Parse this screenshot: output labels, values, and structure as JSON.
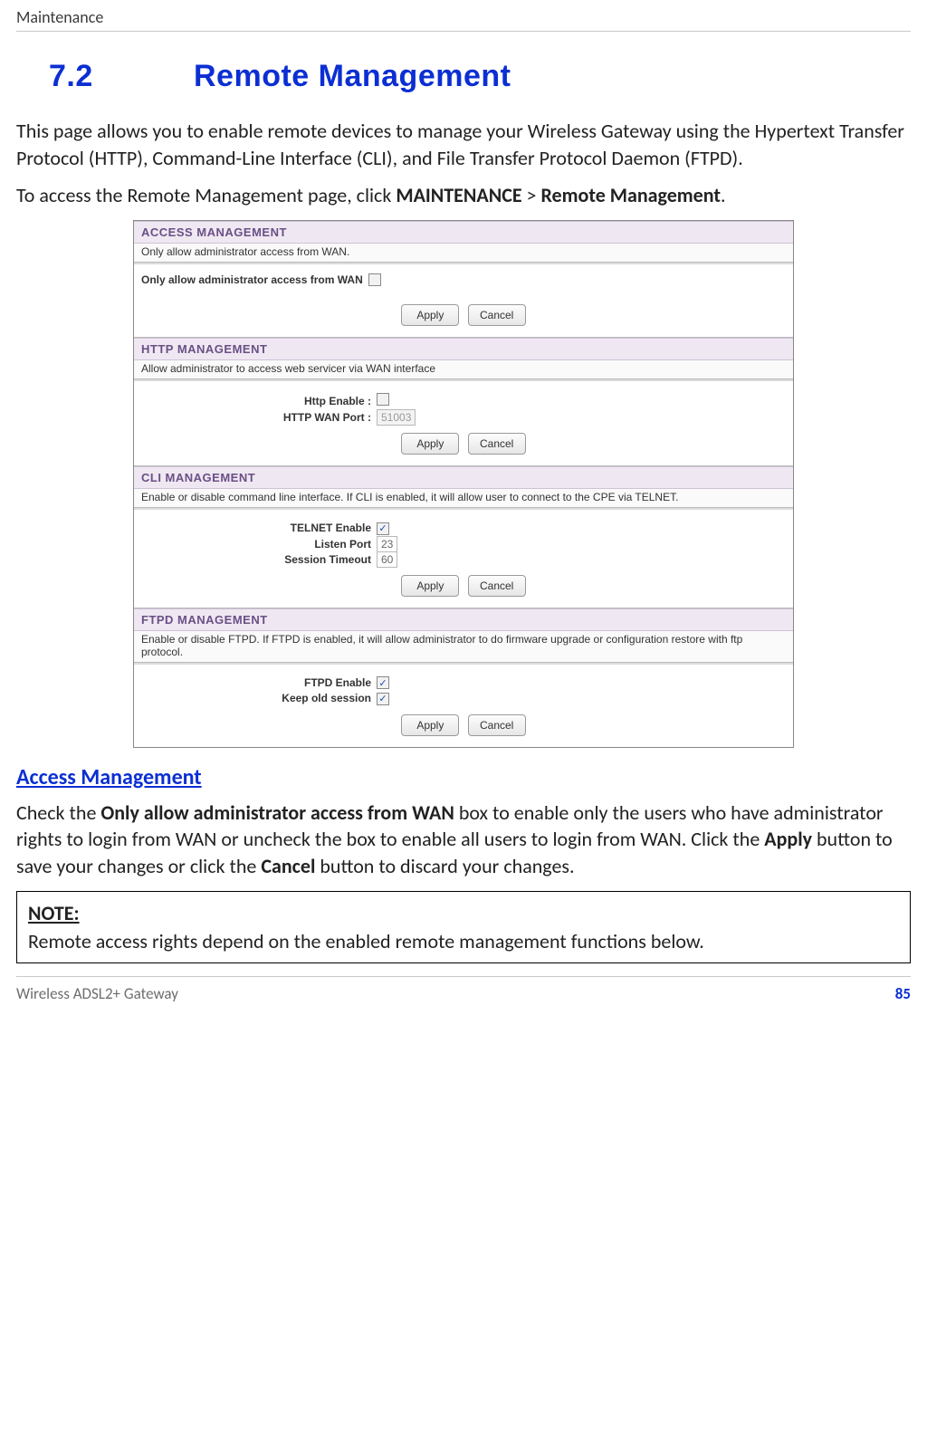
{
  "header": {
    "chapter": "Maintenance"
  },
  "section": {
    "number": "7.2",
    "title": "Remote Management"
  },
  "intro": {
    "p1": "This page allows you to enable remote devices to manage your Wireless Gateway using the Hypertext Transfer Protocol (HTTP), Command-Line Interface (CLI), and File Transfer Protocol Daemon (FTPD).",
    "p2a": "To access the Remote Management page, click ",
    "p2b": "MAINTENANCE",
    "p2c": " > ",
    "p2d": "Remote Management",
    "p2e": "."
  },
  "buttons": {
    "apply": "Apply",
    "cancel": "Cancel"
  },
  "shot": {
    "access": {
      "title": "ACCESS MANAGEMENT",
      "desc": "Only allow administrator access from WAN.",
      "checkbox_label": "Only allow administrator access from WAN",
      "checked": ""
    },
    "http": {
      "title": "HTTP MANAGEMENT",
      "desc": "Allow administrator to access web servicer via WAN interface",
      "enable_label": "Http Enable  :",
      "port_label": "HTTP WAN Port  :",
      "port_value": "51003",
      "enable_checked": ""
    },
    "cli": {
      "title": "CLI MANAGEMENT",
      "desc": "Enable or disable command line interface. If CLI is enabled, it will allow user to connect to the CPE via TELNET.",
      "telnet_label": "TELNET Enable",
      "telnet_checked": "✓",
      "listen_label": "Listen Port",
      "listen_value": "23",
      "timeout_label": "Session Timeout",
      "timeout_value": "60"
    },
    "ftpd": {
      "title": "FTPD MANAGEMENT",
      "desc": "Enable or disable FTPD. If FTPD is enabled, it will allow administrator to do firmware upgrade or configuration restore with ftp protocol.",
      "enable_label": "FTPD Enable",
      "enable_checked": "✓",
      "keep_label": "Keep old session",
      "keep_checked": "✓"
    }
  },
  "access_mgmt": {
    "heading": "Access Management",
    "p_a": "Check the ",
    "p_b": "Only allow administrator access from WAN",
    "p_c": " box to enable only the users who have administrator rights to login from WAN or uncheck the box to enable all users to login from WAN. Click the ",
    "p_d": "Apply",
    "p_e": " button to save your changes or click the ",
    "p_f": "Cancel",
    "p_g": " button to discard your changes."
  },
  "note": {
    "label": "NOTE:",
    "text": "Remote access rights depend on the enabled remote management functions below."
  },
  "footer": {
    "product": "Wireless ADSL2+ Gateway",
    "page": "85"
  }
}
